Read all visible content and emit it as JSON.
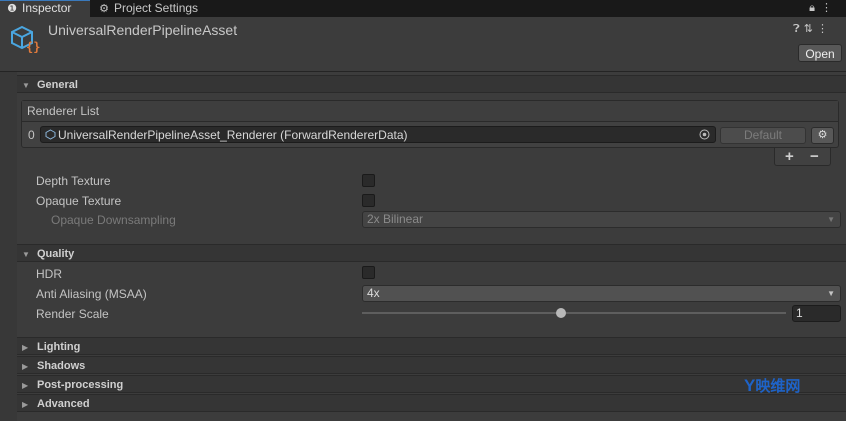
{
  "tabs": {
    "inspector": "Inspector",
    "project_settings": "Project Settings"
  },
  "asset": {
    "title": "UniversalRenderPipelineAsset",
    "open_button": "Open"
  },
  "sections": {
    "general": "General",
    "quality": "Quality",
    "lighting": "Lighting",
    "shadows": "Shadows",
    "post_processing": "Post-processing",
    "advanced": "Advanced"
  },
  "renderer_list": {
    "header": "Renderer List",
    "index": "0",
    "value": "UniversalRenderPipelineAsset_Renderer (ForwardRendererData)",
    "default_button": "Default",
    "add": "+",
    "remove": "−"
  },
  "general": {
    "depth_texture": {
      "label": "Depth Texture",
      "checked": false
    },
    "opaque_texture": {
      "label": "Opaque Texture",
      "checked": false
    },
    "opaque_downsampling": {
      "label": "Opaque Downsampling",
      "value": "2x Bilinear"
    }
  },
  "quality": {
    "hdr": {
      "label": "HDR",
      "checked": false
    },
    "anti_aliasing": {
      "label": "Anti Aliasing (MSAA)",
      "value": "4x"
    },
    "render_scale": {
      "label": "Render Scale",
      "value": "1",
      "fraction": 0.47
    }
  },
  "watermark": {
    "y": "Y",
    "text": "映维网"
  },
  "icons": {
    "inspector": "info-icon",
    "project_settings": "gear-icon",
    "lock": "lock-icon",
    "menu": "kebab-menu-icon",
    "help": "help-icon",
    "presets": "presets-icon",
    "more": "more-icon",
    "asset": "urp-asset-icon",
    "object_picker": "object-picker-icon"
  },
  "colors": {
    "accent": "#3a79bb",
    "asset_icon_blue": "#4aa6e0",
    "asset_icon_orange": "#e07a3c",
    "watermark_blue": "#1e63c8"
  }
}
